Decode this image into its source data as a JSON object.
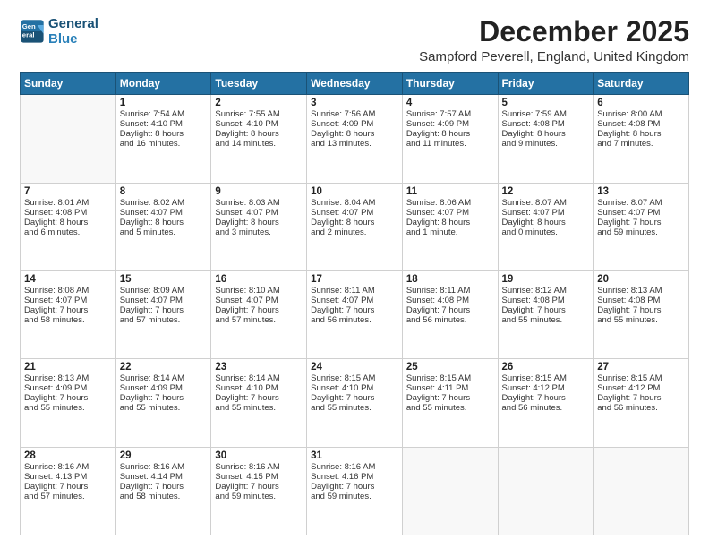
{
  "logo": {
    "line1": "General",
    "line2": "Blue"
  },
  "title": "December 2025",
  "location": "Sampford Peverell, England, United Kingdom",
  "weekdays": [
    "Sunday",
    "Monday",
    "Tuesday",
    "Wednesday",
    "Thursday",
    "Friday",
    "Saturday"
  ],
  "weeks": [
    [
      {
        "day": "",
        "info": ""
      },
      {
        "day": "1",
        "info": "Sunrise: 7:54 AM\nSunset: 4:10 PM\nDaylight: 8 hours\nand 16 minutes."
      },
      {
        "day": "2",
        "info": "Sunrise: 7:55 AM\nSunset: 4:10 PM\nDaylight: 8 hours\nand 14 minutes."
      },
      {
        "day": "3",
        "info": "Sunrise: 7:56 AM\nSunset: 4:09 PM\nDaylight: 8 hours\nand 13 minutes."
      },
      {
        "day": "4",
        "info": "Sunrise: 7:57 AM\nSunset: 4:09 PM\nDaylight: 8 hours\nand 11 minutes."
      },
      {
        "day": "5",
        "info": "Sunrise: 7:59 AM\nSunset: 4:08 PM\nDaylight: 8 hours\nand 9 minutes."
      },
      {
        "day": "6",
        "info": "Sunrise: 8:00 AM\nSunset: 4:08 PM\nDaylight: 8 hours\nand 7 minutes."
      }
    ],
    [
      {
        "day": "7",
        "info": "Sunrise: 8:01 AM\nSunset: 4:08 PM\nDaylight: 8 hours\nand 6 minutes."
      },
      {
        "day": "8",
        "info": "Sunrise: 8:02 AM\nSunset: 4:07 PM\nDaylight: 8 hours\nand 5 minutes."
      },
      {
        "day": "9",
        "info": "Sunrise: 8:03 AM\nSunset: 4:07 PM\nDaylight: 8 hours\nand 3 minutes."
      },
      {
        "day": "10",
        "info": "Sunrise: 8:04 AM\nSunset: 4:07 PM\nDaylight: 8 hours\nand 2 minutes."
      },
      {
        "day": "11",
        "info": "Sunrise: 8:06 AM\nSunset: 4:07 PM\nDaylight: 8 hours\nand 1 minute."
      },
      {
        "day": "12",
        "info": "Sunrise: 8:07 AM\nSunset: 4:07 PM\nDaylight: 8 hours\nand 0 minutes."
      },
      {
        "day": "13",
        "info": "Sunrise: 8:07 AM\nSunset: 4:07 PM\nDaylight: 7 hours\nand 59 minutes."
      }
    ],
    [
      {
        "day": "14",
        "info": "Sunrise: 8:08 AM\nSunset: 4:07 PM\nDaylight: 7 hours\nand 58 minutes."
      },
      {
        "day": "15",
        "info": "Sunrise: 8:09 AM\nSunset: 4:07 PM\nDaylight: 7 hours\nand 57 minutes."
      },
      {
        "day": "16",
        "info": "Sunrise: 8:10 AM\nSunset: 4:07 PM\nDaylight: 7 hours\nand 57 minutes."
      },
      {
        "day": "17",
        "info": "Sunrise: 8:11 AM\nSunset: 4:07 PM\nDaylight: 7 hours\nand 56 minutes."
      },
      {
        "day": "18",
        "info": "Sunrise: 8:11 AM\nSunset: 4:08 PM\nDaylight: 7 hours\nand 56 minutes."
      },
      {
        "day": "19",
        "info": "Sunrise: 8:12 AM\nSunset: 4:08 PM\nDaylight: 7 hours\nand 55 minutes."
      },
      {
        "day": "20",
        "info": "Sunrise: 8:13 AM\nSunset: 4:08 PM\nDaylight: 7 hours\nand 55 minutes."
      }
    ],
    [
      {
        "day": "21",
        "info": "Sunrise: 8:13 AM\nSunset: 4:09 PM\nDaylight: 7 hours\nand 55 minutes."
      },
      {
        "day": "22",
        "info": "Sunrise: 8:14 AM\nSunset: 4:09 PM\nDaylight: 7 hours\nand 55 minutes."
      },
      {
        "day": "23",
        "info": "Sunrise: 8:14 AM\nSunset: 4:10 PM\nDaylight: 7 hours\nand 55 minutes."
      },
      {
        "day": "24",
        "info": "Sunrise: 8:15 AM\nSunset: 4:10 PM\nDaylight: 7 hours\nand 55 minutes."
      },
      {
        "day": "25",
        "info": "Sunrise: 8:15 AM\nSunset: 4:11 PM\nDaylight: 7 hours\nand 55 minutes."
      },
      {
        "day": "26",
        "info": "Sunrise: 8:15 AM\nSunset: 4:12 PM\nDaylight: 7 hours\nand 56 minutes."
      },
      {
        "day": "27",
        "info": "Sunrise: 8:15 AM\nSunset: 4:12 PM\nDaylight: 7 hours\nand 56 minutes."
      }
    ],
    [
      {
        "day": "28",
        "info": "Sunrise: 8:16 AM\nSunset: 4:13 PM\nDaylight: 7 hours\nand 57 minutes."
      },
      {
        "day": "29",
        "info": "Sunrise: 8:16 AM\nSunset: 4:14 PM\nDaylight: 7 hours\nand 58 minutes."
      },
      {
        "day": "30",
        "info": "Sunrise: 8:16 AM\nSunset: 4:15 PM\nDaylight: 7 hours\nand 59 minutes."
      },
      {
        "day": "31",
        "info": "Sunrise: 8:16 AM\nSunset: 4:16 PM\nDaylight: 7 hours\nand 59 minutes."
      },
      {
        "day": "",
        "info": ""
      },
      {
        "day": "",
        "info": ""
      },
      {
        "day": "",
        "info": ""
      }
    ]
  ]
}
